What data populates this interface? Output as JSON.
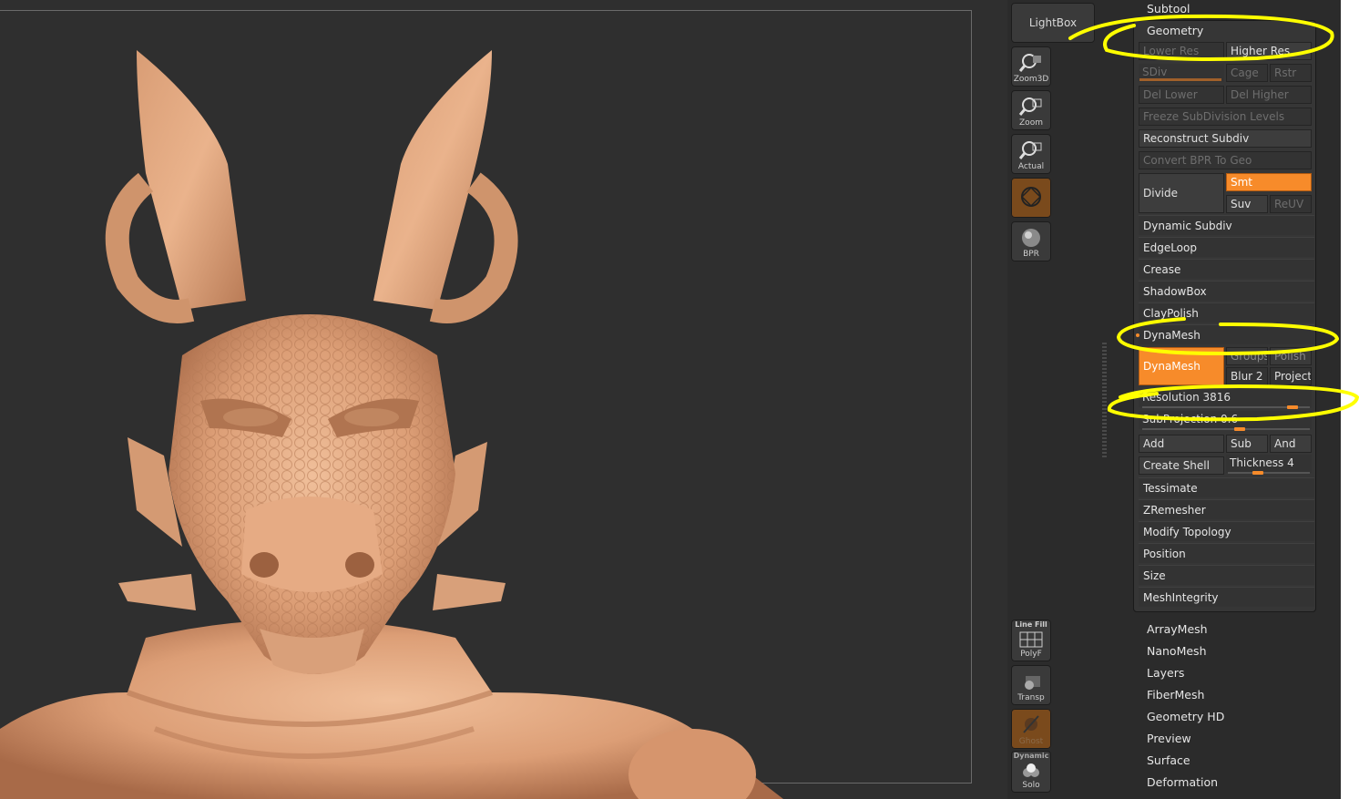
{
  "shelf": {
    "lightbox": "LightBox",
    "zoom3d": "Zoom3D",
    "zoom": "Zoom",
    "actual": "Actual",
    "bpr": "BPR",
    "linefill_title": "Line Fill",
    "polyf": "PolyF",
    "transp": "Transp",
    "ghost": "Ghost",
    "dynamic_title": "Dynamic",
    "solo": "Solo"
  },
  "panel": {
    "subtool": "Subtool",
    "geometry": {
      "title": "Geometry",
      "lower_res": "Lower Res",
      "higher_res": "Higher Res",
      "sdiv": "SDiv",
      "cage": "Cage",
      "rstr": "Rstr",
      "del_lower": "Del Lower",
      "del_higher": "Del Higher",
      "freeze": "Freeze SubDivision Levels",
      "reconstruct": "Reconstruct Subdiv",
      "convert_bpr": "Convert BPR To Geo",
      "divide": "Divide",
      "smt": "Smt",
      "suv": "Suv",
      "reuv": "ReUV",
      "sections": [
        "Dynamic Subdiv",
        "EdgeLoop",
        "Crease",
        "ShadowBox",
        "ClayPolish"
      ],
      "dynamesh": {
        "title": "DynaMesh",
        "button": "DynaMesh",
        "groups": "Groups",
        "polish": "Polish",
        "blur": "Blur 2",
        "project": "Project",
        "resolution": "Resolution 3816",
        "resolution_value": 3816,
        "subprojection": "SubProjection 0.6",
        "add": "Add",
        "sub": "Sub",
        "and": "And",
        "create_shell": "Create Shell",
        "thickness": "Thickness 4"
      },
      "sections2": [
        "Tessimate",
        "ZRemesher",
        "Modify Topology",
        "Position",
        "Size",
        "MeshIntegrity"
      ]
    },
    "subpalettes": [
      "ArrayMesh",
      "NanoMesh",
      "Layers",
      "FiberMesh",
      "Geometry HD",
      "Preview",
      "Surface",
      "Deformation"
    ]
  },
  "colors": {
    "accent": "#f78b2a",
    "annotation": "#ffff00",
    "model": "#e2a57e",
    "background": "#2f2f2f"
  }
}
